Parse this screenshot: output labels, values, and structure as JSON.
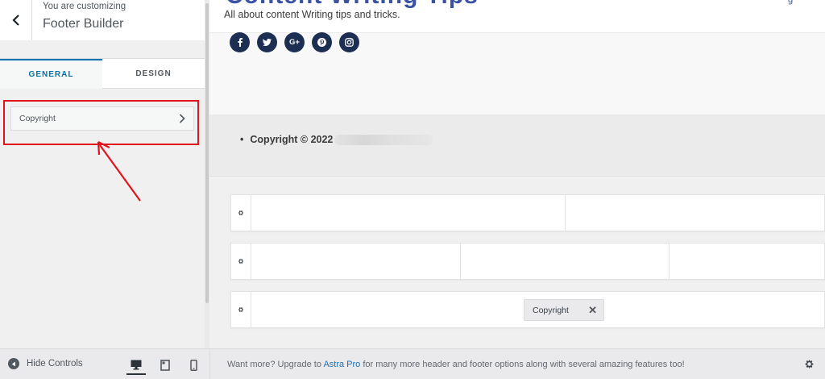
{
  "sidebar": {
    "subtitle": "You are customizing",
    "title": "Footer Builder",
    "tabs": [
      {
        "label": "GENERAL",
        "active": true
      },
      {
        "label": "DESIGN",
        "active": false
      }
    ],
    "section_button": "Copyright"
  },
  "preview": {
    "site_title_fragment": "Content Writing Tips",
    "tagline": "All about content Writing tips and tricks.",
    "top_right_fragment": "g",
    "socials": [
      {
        "icon": "facebook-icon",
        "glyph": "f"
      },
      {
        "icon": "twitter-icon",
        "glyph": "t"
      },
      {
        "icon": "google-plus-icon",
        "glyph": "G+"
      },
      {
        "icon": "pinterest-icon",
        "glyph": "p"
      },
      {
        "icon": "instagram-icon",
        "glyph": "◎"
      }
    ],
    "copyright_text": "Copyright © 2022",
    "builder": {
      "rows": [
        {
          "columns": 2,
          "chip": null
        },
        {
          "columns": 3,
          "chip": null
        },
        {
          "columns": 1,
          "chip": "Copyright"
        }
      ]
    }
  },
  "footer": {
    "hide_controls": "Hide Controls",
    "upgrade_before": "Want more? Upgrade to ",
    "upgrade_link": "Astra Pro",
    "upgrade_after": " for many more header and footer options along with several amazing features too!",
    "devices": [
      "desktop",
      "tablet",
      "mobile"
    ],
    "active_device": "desktop"
  },
  "colors": {
    "accent": "#0073aa",
    "highlight": "#e0141c",
    "social_bg": "#1c2e52",
    "title_blue": "#3a52a3"
  }
}
